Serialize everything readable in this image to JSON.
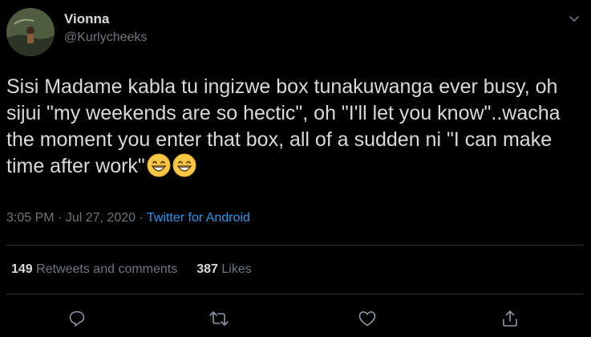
{
  "author": {
    "display_name": "Vionna",
    "handle": "@Kurlycheeks"
  },
  "tweet": {
    "text": "Sisi Madame kabla tu ingizwe box tunakuwanga ever busy, oh sijui \"my weekends are so hectic\", oh \"I'll let you know\"..wacha the moment you enter that box, all of a sudden ni \"I can make time after work\"",
    "emojis": [
      "grinning-face-with-smiling-eyes",
      "grinning-face-with-smiling-eyes"
    ]
  },
  "meta": {
    "time": "3:05 PM",
    "separator1": "·",
    "date": "Jul 27, 2020",
    "separator2": "·",
    "source": "Twitter for Android"
  },
  "stats": {
    "retweets_count": "149",
    "retweets_label": "Retweets and comments",
    "likes_count": "387",
    "likes_label": "Likes"
  },
  "actions": [
    "reply-icon",
    "retweet-icon",
    "like-icon",
    "share-icon"
  ],
  "colors": {
    "background": "#000000",
    "text": "#d9d9d9",
    "secondary": "#6e767d",
    "link": "#1d9bf0",
    "divider": "#2f3336"
  }
}
